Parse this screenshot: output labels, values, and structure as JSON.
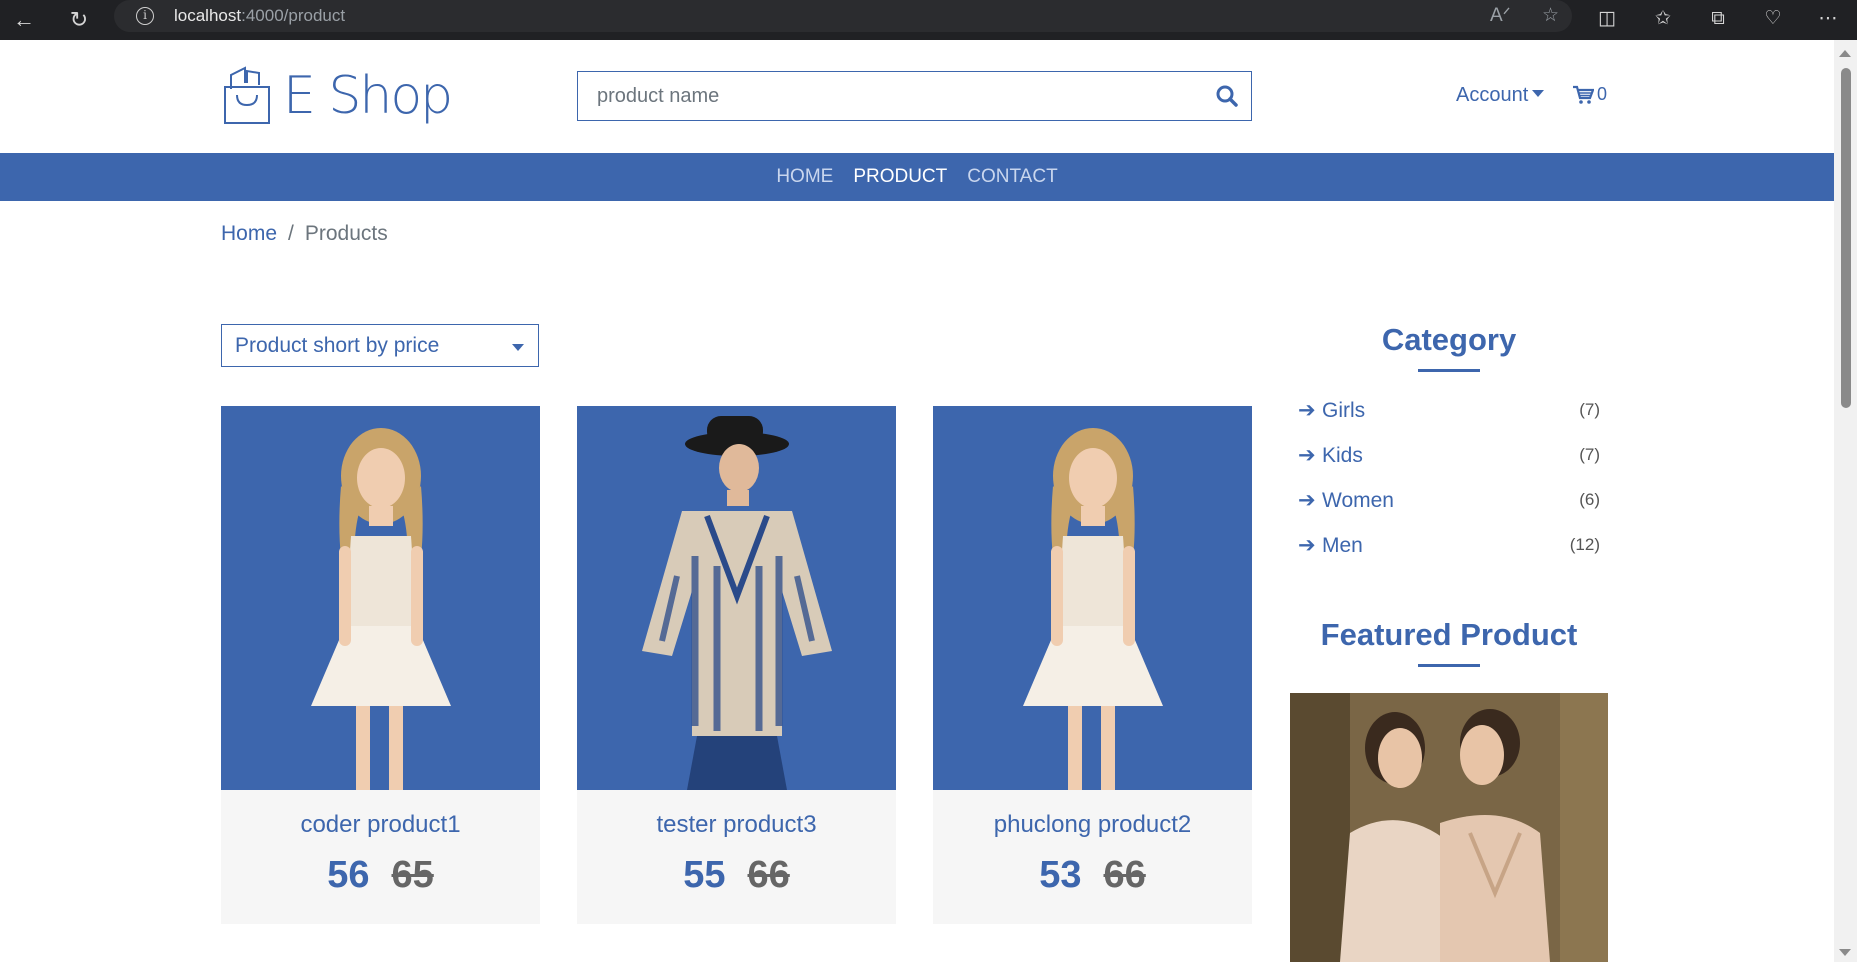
{
  "browser": {
    "url_host": "localhost",
    "url_rest": ":4000/product"
  },
  "header": {
    "brand": "E Shop",
    "search_placeholder": "product name",
    "account_label": "Account",
    "cart_count": "0"
  },
  "nav": {
    "items": [
      {
        "label": "HOME"
      },
      {
        "label": "PRODUCT"
      },
      {
        "label": "CONTACT"
      }
    ]
  },
  "breadcrumb": {
    "home": "Home",
    "separator": "/",
    "current": "Products"
  },
  "sort": {
    "selected": "Product short by price"
  },
  "products": [
    {
      "name": "coder product1",
      "price": "56",
      "old_price": "65"
    },
    {
      "name": "tester product3",
      "price": "55",
      "old_price": "66"
    },
    {
      "name": "phuclong product2",
      "price": "53",
      "old_price": "66"
    }
  ],
  "sidebar": {
    "category_title": "Category",
    "categories": [
      {
        "label": "Girls",
        "count": "(7)"
      },
      {
        "label": "Kids",
        "count": "(7)"
      },
      {
        "label": "Women",
        "count": "(6)"
      },
      {
        "label": "Men",
        "count": "(12)"
      }
    ],
    "featured_title": "Featured Product"
  },
  "colors": {
    "brand": "#3d66ad",
    "card_bg": "#f6f6f6"
  }
}
